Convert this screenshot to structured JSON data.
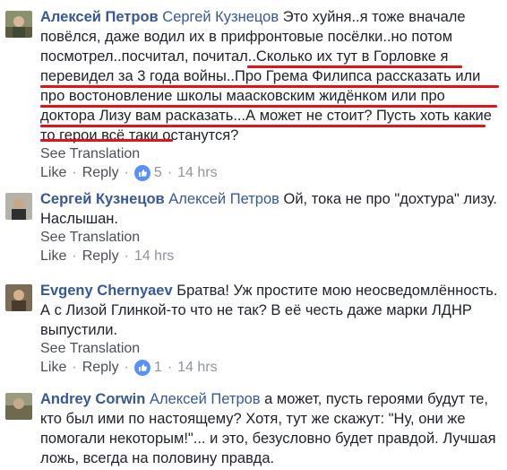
{
  "comments": [
    {
      "author": "Алексей Петров",
      "reply_to": "Сергей Кузнецов",
      "text": "Это хуйня..я тоже вначале повёлся, даже водил их в прифронтовые посёлки..но потом посмотрел..посчитал, почитал..Сколько их тут в Горловке я перевидел за 3 года войны..Про Грема Филипса рассказать или про востоновление школы маасковским жидёнком или про доктора Лизу вам расказать...А может не стоит? Пусть хоть какие то герои всё таки останутся?",
      "see_translation": "See Translation",
      "like": "Like",
      "reply": "Reply",
      "reactions": "5",
      "time": "14 hrs"
    },
    {
      "author": "Сергей Кузнецов",
      "reply_to": "Алексей Петров",
      "text": "Ой, тока не про \"дохтура\" лизу. Наслышан.",
      "see_translation": "See Translation",
      "like": "Like",
      "reply": "Reply",
      "time": "14 hrs"
    },
    {
      "author": "Evgeny Chernyaev",
      "reply_to": "",
      "text": "Братва! Уж простите мою неосведомлённость. А с Лизой Глинкой-то что не так? В её честь даже марки ЛДНР выпустили.",
      "see_translation": "See Translation",
      "like": "Like",
      "reply": "Reply",
      "reactions": "1",
      "time": "14 hrs"
    },
    {
      "author": "Andrey Corwin",
      "reply_to": "Алексей Петров",
      "text": "а может, пусть героями будут те, кто был ими по настоящему? Хотя, тут же скажут: \"Ну, они же помогали некоторым!\"... и это, безусловно будет правдой. Лучшая ложь, всегда на половину правда."
    }
  ],
  "colors": {
    "name": "#365899",
    "text": "#1d2129",
    "meta": "#90949c",
    "link": "#4b4f56",
    "like_badge": "#5890ff",
    "underline": "#e0151a"
  },
  "icons": {
    "like_badge": "thumbs-up-icon"
  }
}
